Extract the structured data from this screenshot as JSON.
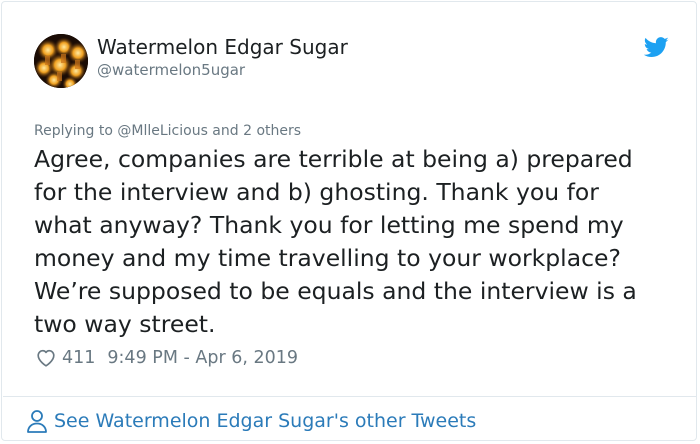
{
  "author": {
    "display_name": "Watermelon Edgar Sugar",
    "handle": "@watermelon5ugar"
  },
  "tweet": {
    "reply_context": "Replying to @MlleLicious and 2 others",
    "text_lines": [
      "Agree, companies are terrible at being a) prepared",
      "for the interview and b) ghosting. Thank you for",
      "what anyway? Thank you for letting me spend my",
      "money and my time travelling to your workplace?",
      "We’re supposed to be equals and the interview is a",
      "two way street."
    ],
    "like_count": "411",
    "timestamp": "9:49 PM - Apr 6, 2019"
  },
  "footer": {
    "link_label": "See Watermelon Edgar Sugar's other Tweets"
  },
  "icons": {
    "brand": "twitter-bird-icon",
    "like": "heart-icon",
    "profile": "person-icon"
  },
  "colors": {
    "brand_blue": "#1da1f2",
    "link_blue": "#2b7bb9",
    "muted_text": "#697882",
    "primary_text": "#1c2022",
    "border": "#e1e8ed"
  }
}
